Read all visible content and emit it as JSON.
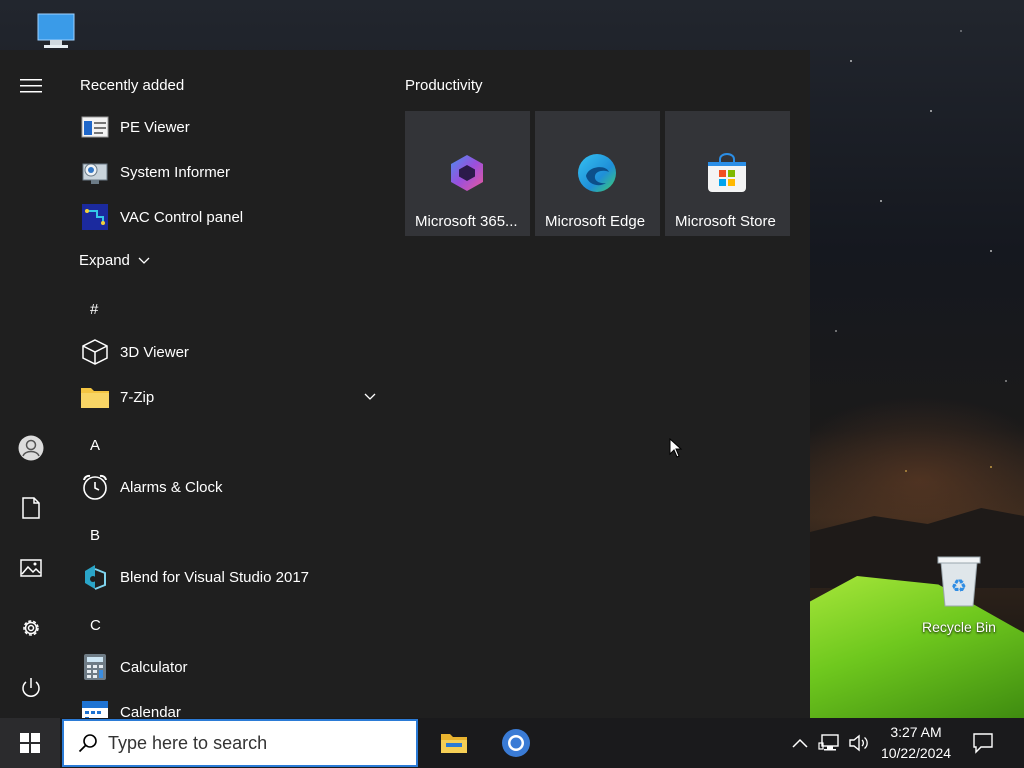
{
  "desktop": {
    "recycle_bin_label": "Recycle Bin"
  },
  "start_menu": {
    "recently_added_title": "Recently added",
    "recent_apps": [
      {
        "label": "PE Viewer",
        "icon": "pe-viewer-icon"
      },
      {
        "label": "System Informer",
        "icon": "system-informer-icon"
      },
      {
        "label": "VAC Control panel",
        "icon": "vac-control-icon"
      }
    ],
    "expand_label": "Expand",
    "sections": [
      {
        "letter": "#",
        "apps": [
          {
            "label": "3D Viewer",
            "icon": "cube-icon"
          },
          {
            "label": "7-Zip",
            "icon": "folder-icon",
            "expandable": true
          }
        ]
      },
      {
        "letter": "A",
        "apps": [
          {
            "label": "Alarms & Clock",
            "icon": "alarm-clock-icon"
          }
        ]
      },
      {
        "letter": "B",
        "apps": [
          {
            "label": "Blend for Visual Studio 2017",
            "icon": "blend-icon"
          }
        ]
      },
      {
        "letter": "C",
        "apps": [
          {
            "label": "Calculator",
            "icon": "calculator-icon"
          },
          {
            "label": "Calendar",
            "icon": "calendar-icon"
          }
        ]
      }
    ],
    "tile_group_title": "Productivity",
    "tiles": [
      {
        "label": "Microsoft 365...",
        "icon": "microsoft-365-icon"
      },
      {
        "label": "Microsoft Edge",
        "icon": "edge-icon"
      },
      {
        "label": "Microsoft Store",
        "icon": "store-icon"
      }
    ]
  },
  "taskbar": {
    "search_placeholder": "Type here to search",
    "time": "3:27 AM",
    "date": "10/22/2024"
  }
}
